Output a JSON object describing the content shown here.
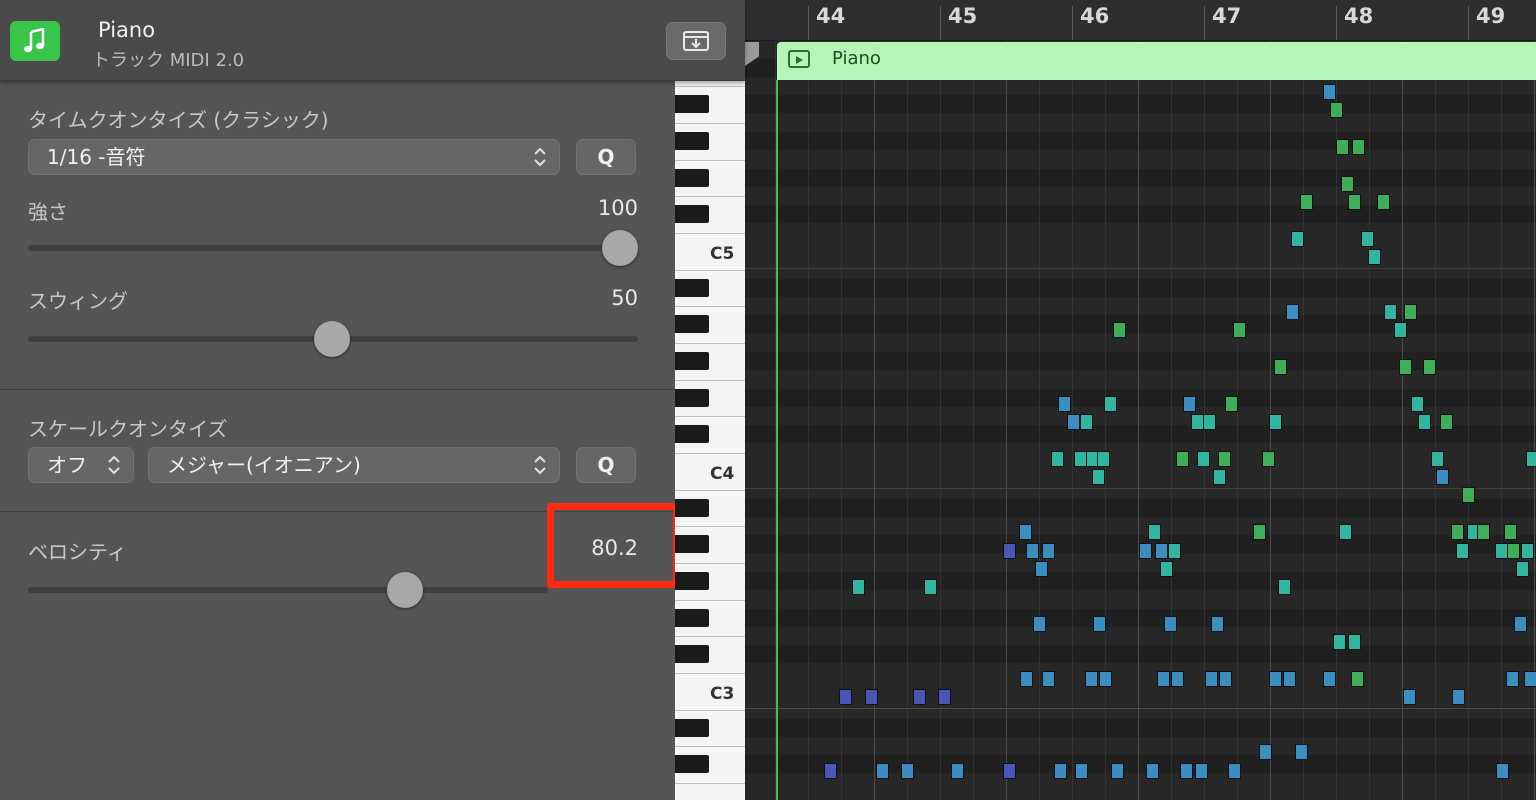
{
  "track": {
    "name": "Piano",
    "subtitle": "トラック MIDI 2.0",
    "icon": "music-note-icon",
    "icon_color": "#39c44a"
  },
  "time_quantize": {
    "label": "タイムクオンタイズ (クラシック)",
    "value": "1/16 -音符",
    "q_label": "Q",
    "strength_label": "強さ",
    "strength_value": "100",
    "strength_fraction": 1.0,
    "swing_label": "スウィング",
    "swing_value": "50",
    "swing_fraction": 0.5
  },
  "scale_quantize": {
    "label": "スケールクオンタイズ",
    "mode": "オフ",
    "scale": "メジャー(イオニアン)",
    "q_label": "Q"
  },
  "velocity": {
    "label": "ベロシティ",
    "value": "80.2",
    "fraction": 0.63,
    "highlight_color": "#ff2a12"
  },
  "keyboard": {
    "labels": [
      "C5",
      "C4",
      "C3"
    ]
  },
  "ruler": {
    "bars": [
      "44",
      "45",
      "46",
      "47",
      "48",
      "49"
    ]
  },
  "region": {
    "name": "Piano",
    "color": "#b6f5b8"
  }
}
